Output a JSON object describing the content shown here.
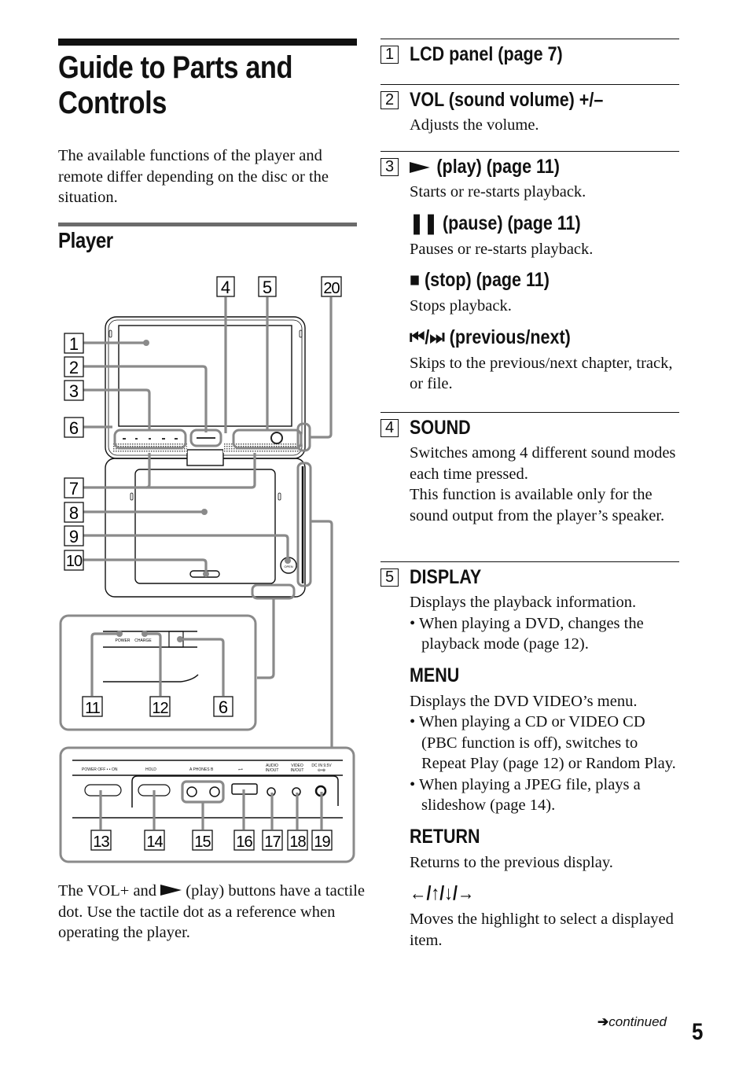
{
  "page": {
    "title_line1": "Guide to Parts and",
    "title_line2": "Controls",
    "intro": "The available functions of the player and remote differ depending on the disc or the situation.",
    "section_heading": "Player",
    "note_before": "The VOL+ and",
    "note_after": "(play) buttons have a tactile dot. Use the tactile dot as a reference when operating the player.",
    "footer_continued": "continued",
    "page_number": "5"
  },
  "diagram": {
    "callouts_top": [
      "4",
      "5",
      "20"
    ],
    "callouts_left": [
      "1",
      "2",
      "3",
      "6",
      "7",
      "8",
      "9",
      "10"
    ],
    "callouts_inset": [
      "11",
      "12",
      "6"
    ],
    "callouts_bottom": [
      "13",
      "14",
      "15",
      "16",
      "17",
      "18",
      "19"
    ],
    "inset_labels": {
      "power": "POWER",
      "charge": "CHARGE"
    },
    "panel_labels": {
      "power_switch": "POWER  OFF • • ON",
      "hold": "HOLD",
      "phones": "A  PHONES  B",
      "usb": "USB",
      "audio": [
        "AUDIO",
        "IN/OUT"
      ],
      "video": [
        "VIDEO",
        "IN/OUT"
      ],
      "dc": [
        "DC IN 9.5V",
        "⊖•⊕"
      ]
    },
    "device_labels": {
      "open": "OPEN"
    }
  },
  "sections": [
    {
      "num": "1",
      "title": "LCD panel (page 7)"
    },
    {
      "num": "2",
      "title": "VOL (sound volume) +/–",
      "desc": "Adjusts the volume."
    },
    {
      "num": "3",
      "title": "(play) (page 11)",
      "desc": "Starts or re-starts playback.",
      "subs": [
        {
          "glyph": "❚❚",
          "title": "(pause) (page 11)",
          "desc": "Pauses or re-starts playback."
        },
        {
          "glyph": "■",
          "title": "(stop) (page 11)",
          "desc": "Stops playback."
        },
        {
          "glyph": "⏮/⏭",
          "title": "(previous/next)",
          "desc": "Skips to the previous/next chapter, track, or file."
        }
      ]
    },
    {
      "num": "4",
      "title": "SOUND",
      "desc": "Switches among 4 different sound modes each time pressed.",
      "desc2": "This function is available only for the sound output from the player’s speaker."
    },
    {
      "num": "5",
      "title": "DISPLAY",
      "desc": "Displays the playback information.",
      "bullets": [
        "When playing a DVD, changes the playback mode (page 12)."
      ],
      "subs": [
        {
          "title": "MENU",
          "desc": "Displays the DVD VIDEO’s menu.",
          "bullets": [
            "When playing a CD or VIDEO CD (PBC function is off), switches to Repeat Play (page 12) or Random Play.",
            "When playing a JPEG file, plays a slideshow (page 14)."
          ]
        },
        {
          "title": "RETURN",
          "desc": "Returns to the previous display."
        },
        {
          "title": "←/↑/↓/→",
          "desc": "Moves the highlight to select a displayed item."
        }
      ]
    }
  ]
}
